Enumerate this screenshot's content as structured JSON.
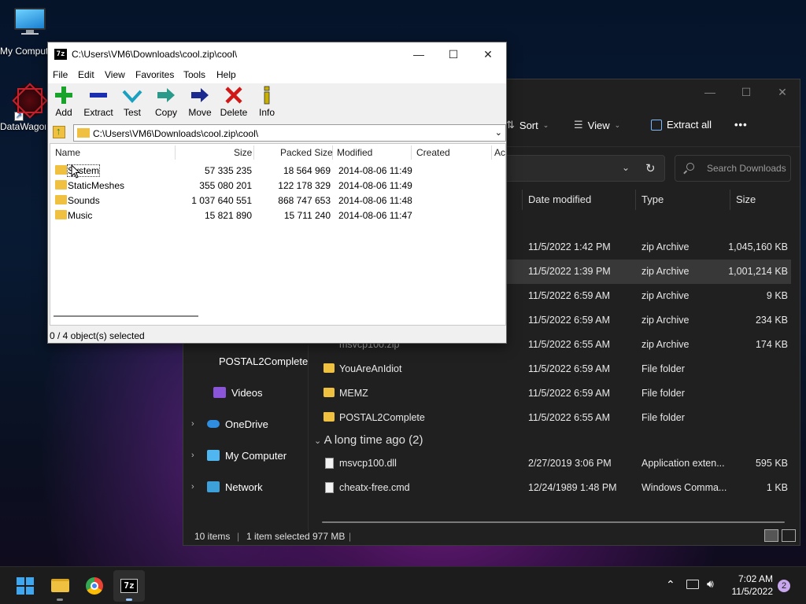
{
  "desktop": {
    "icons": [
      {
        "label": "My Computer"
      },
      {
        "label": "DataWagon"
      }
    ]
  },
  "explorer": {
    "toolbar": {
      "sort": "Sort",
      "view": "View",
      "extract_all": "Extract all",
      "more": "•••"
    },
    "search_placeholder": "Search Downloads",
    "columns": [
      "Date modified",
      "Type",
      "Size"
    ],
    "files": [
      {
        "name": "",
        "date": "11/5/2022 1:42 PM",
        "type": "zip Archive",
        "size": "1,045,160 KB"
      },
      {
        "name": "",
        "date": "11/5/2022 1:39 PM",
        "type": "zip Archive",
        "size": "1,001,214 KB"
      },
      {
        "name": "",
        "date": "11/5/2022 6:59 AM",
        "type": "zip Archive",
        "size": "9 KB"
      },
      {
        "name": "",
        "date": "11/5/2022 6:59 AM",
        "type": "zip Archive",
        "size": "234 KB"
      },
      {
        "name": "msvcp100.zip",
        "date": "11/5/2022 6:55 AM",
        "type": "zip Archive",
        "size": "174 KB"
      },
      {
        "name": "YouAreAnIdiot",
        "date": "11/5/2022 6:59 AM",
        "type": "File folder",
        "size": ""
      },
      {
        "name": "MEMZ",
        "date": "11/5/2022 6:59 AM",
        "type": "File folder",
        "size": ""
      },
      {
        "name": "POSTAL2Complete",
        "date": "11/5/2022 6:55 AM",
        "type": "File folder",
        "size": ""
      }
    ],
    "group_title": "A long time ago (2)",
    "old_files": [
      {
        "name": "msvcp100.dll",
        "date": "2/27/2019 3:06 PM",
        "type": "Application exten...",
        "size": "595 KB"
      },
      {
        "name": "cheatx-free.cmd",
        "date": "12/24/1989 1:48 PM",
        "type": "Windows Comma...",
        "size": "1 KB"
      }
    ],
    "nav": [
      {
        "label": "POSTAL2Complete"
      },
      {
        "label": "Videos"
      },
      {
        "label": "OneDrive"
      },
      {
        "label": "My Computer"
      },
      {
        "label": "Network"
      }
    ],
    "status": {
      "items": "10 items",
      "selected": "1 item selected",
      "size": "977 MB"
    }
  },
  "sevenzip": {
    "title": "C:\\Users\\VM6\\Downloads\\cool.zip\\cool\\",
    "logo": "7z",
    "menu": [
      "File",
      "Edit",
      "View",
      "Favorites",
      "Tools",
      "Help"
    ],
    "tools": [
      {
        "label": "Add",
        "icon": "plus-icon",
        "color": "#1aa32a"
      },
      {
        "label": "Extract",
        "icon": "minus-icon",
        "color": "#1a2fb0"
      },
      {
        "label": "Test",
        "icon": "check-icon",
        "color": "#1aa0c0"
      },
      {
        "label": "Copy",
        "icon": "arrow-right-icon",
        "color": "#2a9a8a"
      },
      {
        "label": "Move",
        "icon": "arrow-right-icon",
        "color": "#1a2a90"
      },
      {
        "label": "Delete",
        "icon": "x-icon",
        "color": "#d01818"
      },
      {
        "label": "Info",
        "icon": "info-icon",
        "color": "#c8b000"
      }
    ],
    "address": "C:\\Users\\VM6\\Downloads\\cool.zip\\cool\\",
    "columns": [
      "Name",
      "Size",
      "Packed Size",
      "Modified",
      "Created",
      "Ac"
    ],
    "rows": [
      {
        "name": "System",
        "size": "57 335 235",
        "packed": "18 564 969",
        "modified": "2014-08-06 11:49"
      },
      {
        "name": "StaticMeshes",
        "size": "355 080 201",
        "packed": "122 178 329",
        "modified": "2014-08-06 11:49"
      },
      {
        "name": "Sounds",
        "size": "1 037 640 551",
        "packed": "868 747 653",
        "modified": "2014-08-06 11:48"
      },
      {
        "name": "Music",
        "size": "15 821 890",
        "packed": "15 711 240",
        "modified": "2014-08-06 11:47"
      }
    ],
    "status": "0 / 4 object(s) selected"
  },
  "taskbar": {
    "time": "7:02 AM",
    "date": "11/5/2022",
    "notifications": "2"
  }
}
